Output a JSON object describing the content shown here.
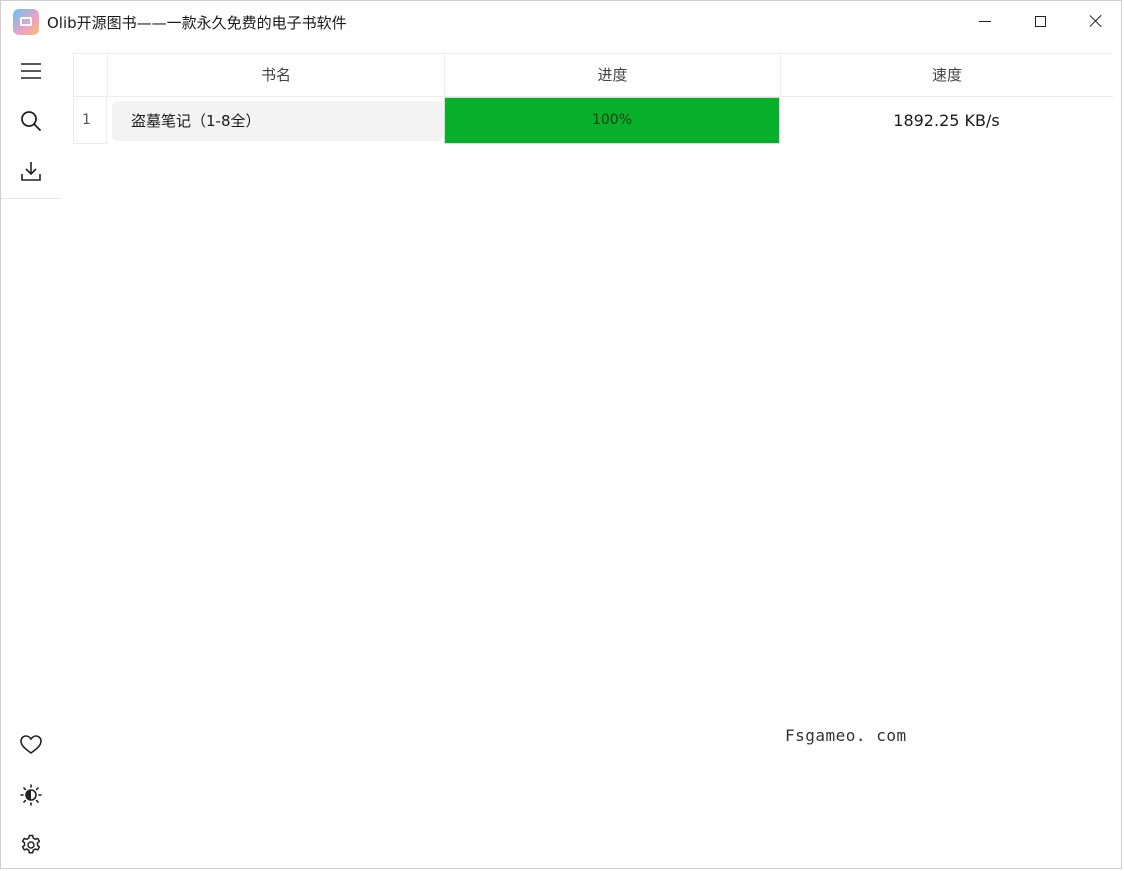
{
  "window": {
    "title": "Olib开源图书——一款永久免费的电子书软件"
  },
  "icons": {
    "app": "app-icon",
    "menu": "hamburger-menu-icon",
    "search": "search-icon",
    "download": "download-icon",
    "favorite": "heart-icon",
    "theme": "theme-contrast-icon",
    "settings": "gear-icon"
  },
  "table": {
    "columns": [
      "书名",
      "进度",
      "速度"
    ],
    "rows": [
      {
        "index": "1",
        "name": "盗墓笔记（1-8全）",
        "progress": "100%",
        "progress_value": 100,
        "speed": "1892.25 KB/s"
      }
    ]
  },
  "colors": {
    "progress": "#07b02a"
  },
  "watermark": "Fsgameo. com"
}
